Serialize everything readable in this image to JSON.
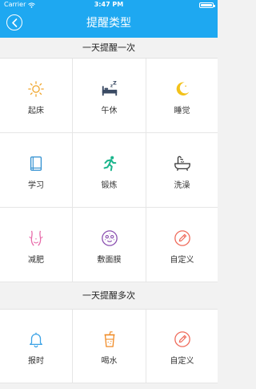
{
  "status_bar": {
    "carrier": "Carrier",
    "time": "3:47 PM"
  },
  "nav": {
    "title": "提醒类型",
    "back_icon": "back-arrow-icon"
  },
  "sections": [
    {
      "title": "一天提醒一次",
      "items": [
        {
          "label": "起床",
          "icon": "sun-icon",
          "color": "#f0a52a"
        },
        {
          "label": "午休",
          "icon": "bed-icon",
          "color": "#3a4a63"
        },
        {
          "label": "睡觉",
          "icon": "moon-icon",
          "color": "#f3c21b"
        },
        {
          "label": "学习",
          "icon": "book-icon",
          "color": "#2f8fd0"
        },
        {
          "label": "锻炼",
          "icon": "running-icon",
          "color": "#1bb58c"
        },
        {
          "label": "洗澡",
          "icon": "bathtub-icon",
          "color": "#333333"
        },
        {
          "label": "减肥",
          "icon": "body-icon",
          "color": "#e86aa9"
        },
        {
          "label": "敷面膜",
          "icon": "face-mask-icon",
          "color": "#8a4fb0"
        },
        {
          "label": "自定义",
          "icon": "edit-circle-icon",
          "color": "#ef6a5a"
        }
      ]
    },
    {
      "title": "一天提醒多次",
      "items": [
        {
          "label": "报时",
          "icon": "bell-icon",
          "color": "#3aa2e6"
        },
        {
          "label": "喝水",
          "icon": "cup-icon",
          "color": "#f08a24"
        },
        {
          "label": "自定义",
          "icon": "edit-circle-icon",
          "color": "#ef6a5a"
        }
      ]
    }
  ]
}
